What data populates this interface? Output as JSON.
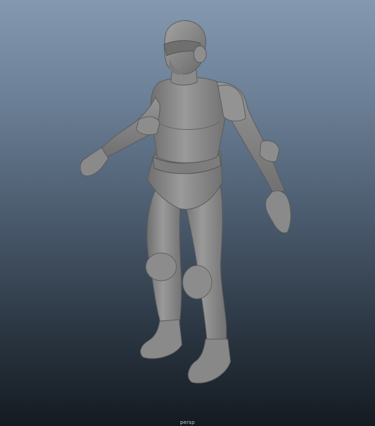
{
  "viewport": {
    "camera_label": "persp",
    "background": {
      "top": "#8499b0",
      "bottom": "#141a21"
    },
    "model": {
      "icon": "3d-character-mesh",
      "shading": "default-gray",
      "color": "#8a8a8a"
    }
  }
}
